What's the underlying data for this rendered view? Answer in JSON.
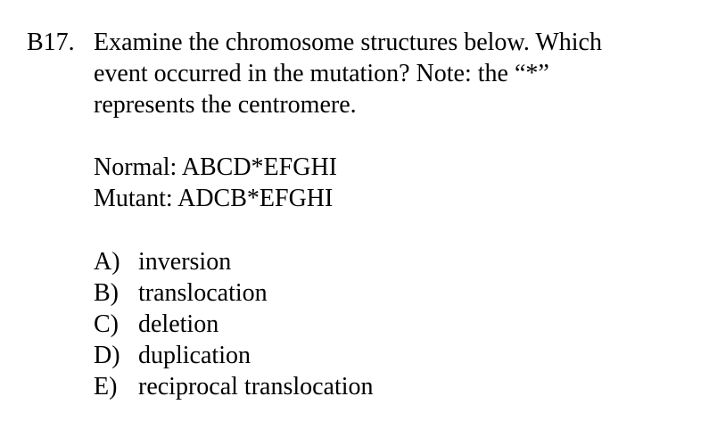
{
  "question": {
    "number": "B17.",
    "stem_lines": [
      "Examine the chromosome structures below. Which",
      "event occurred in the mutation? Note: the “*”",
      "represents the centromere."
    ],
    "normal": "Normal: ABCD*EFGHI",
    "mutant": "Mutant: ADCB*EFGHI",
    "options": [
      {
        "letter": "A)",
        "text": "inversion"
      },
      {
        "letter": "B)",
        "text": "translocation"
      },
      {
        "letter": "C)",
        "text": "deletion"
      },
      {
        "letter": "D)",
        "text": "duplication"
      },
      {
        "letter": "E)",
        "text": "reciprocal translocation"
      }
    ]
  }
}
